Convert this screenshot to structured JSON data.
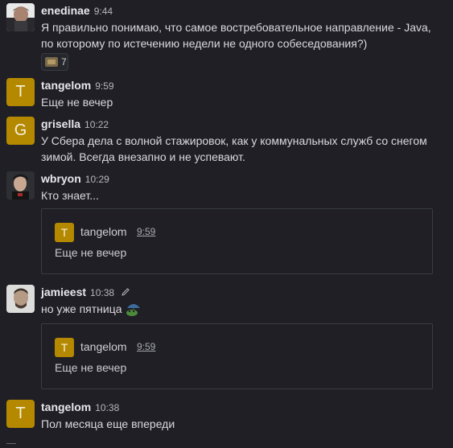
{
  "colors": {
    "background": "#1f1f25",
    "tangelom_avatar": "#b48900",
    "grisella_avatar": "#b48900"
  },
  "messages": [
    {
      "username": "enedinae",
      "time": "9:44",
      "text": "Я правильно понимаю, что самое востребовательное направление - Java, по которому по истечению недели не одного собеседования?)",
      "reaction_count": "7"
    },
    {
      "username": "tangelom",
      "avatar_letter": "T",
      "time": "9:59",
      "text": "Еще не вечер"
    },
    {
      "username": "grisella",
      "avatar_letter": "G",
      "time": "10:22",
      "text": "У Сбера дела с волной стажировок, как у коммунальных служб со снегом зимой. Всегда внезапно и не успевают."
    },
    {
      "username": "wbryon",
      "time": "10:29",
      "text": "Кто знает...",
      "quote": {
        "avatar_letter": "T",
        "username": "tangelom",
        "time": "9:59",
        "text": "Еще не вечер"
      }
    },
    {
      "username": "jamieest",
      "time": "10:38",
      "edited_icon": "pencil-icon",
      "text": "но уже пятница",
      "inline_emoji": "frog-umbrella-emoji",
      "quote": {
        "avatar_letter": "T",
        "username": "tangelom",
        "time": "9:59",
        "text": "Еще не вечер"
      }
    },
    {
      "username": "tangelom",
      "avatar_letter": "T",
      "time": "10:38",
      "text": "Пол месяца еще впереди"
    }
  ]
}
